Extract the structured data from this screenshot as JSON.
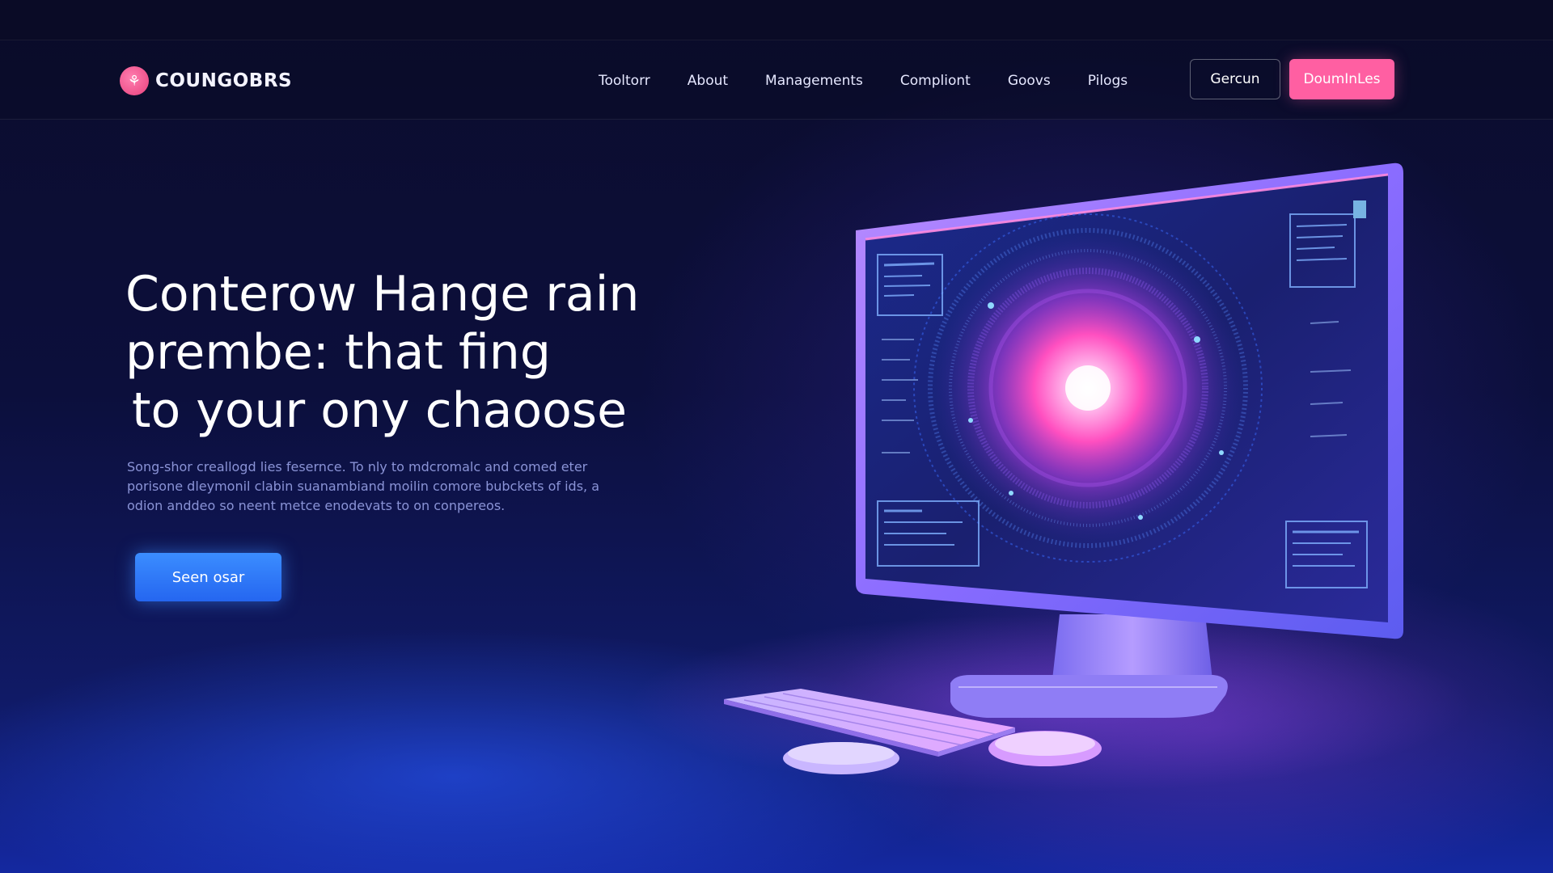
{
  "brand": {
    "name": "COUNGOBRS",
    "mark_glyph": "⚘"
  },
  "nav": {
    "items": [
      "Tooltorr",
      "About",
      "Managements",
      "Compliont",
      "Goovs",
      "Pilogs"
    ]
  },
  "header_actions": {
    "secondary_label": "Gercun",
    "primary_label": "DoumInLes"
  },
  "hero": {
    "title_lines": [
      "Conterow Hange rain",
      "prembe: that fing",
      "to your ony chaoose"
    ],
    "description": "Song-shor creallogd lies fesernce. To nly to mdcromalc and comed eter porisone dleymonil clabin suanambiand moilin comore bubckets of ids, a odion anddeo so neent metce enodevats to on conpereos.",
    "cta_label": "Seen osar"
  },
  "colors": {
    "accent_pink": "#ff5fa2",
    "accent_blue": "#2f7dff",
    "background": "#0a0b2e"
  },
  "icons": {
    "logo": "flower-logo-icon"
  }
}
